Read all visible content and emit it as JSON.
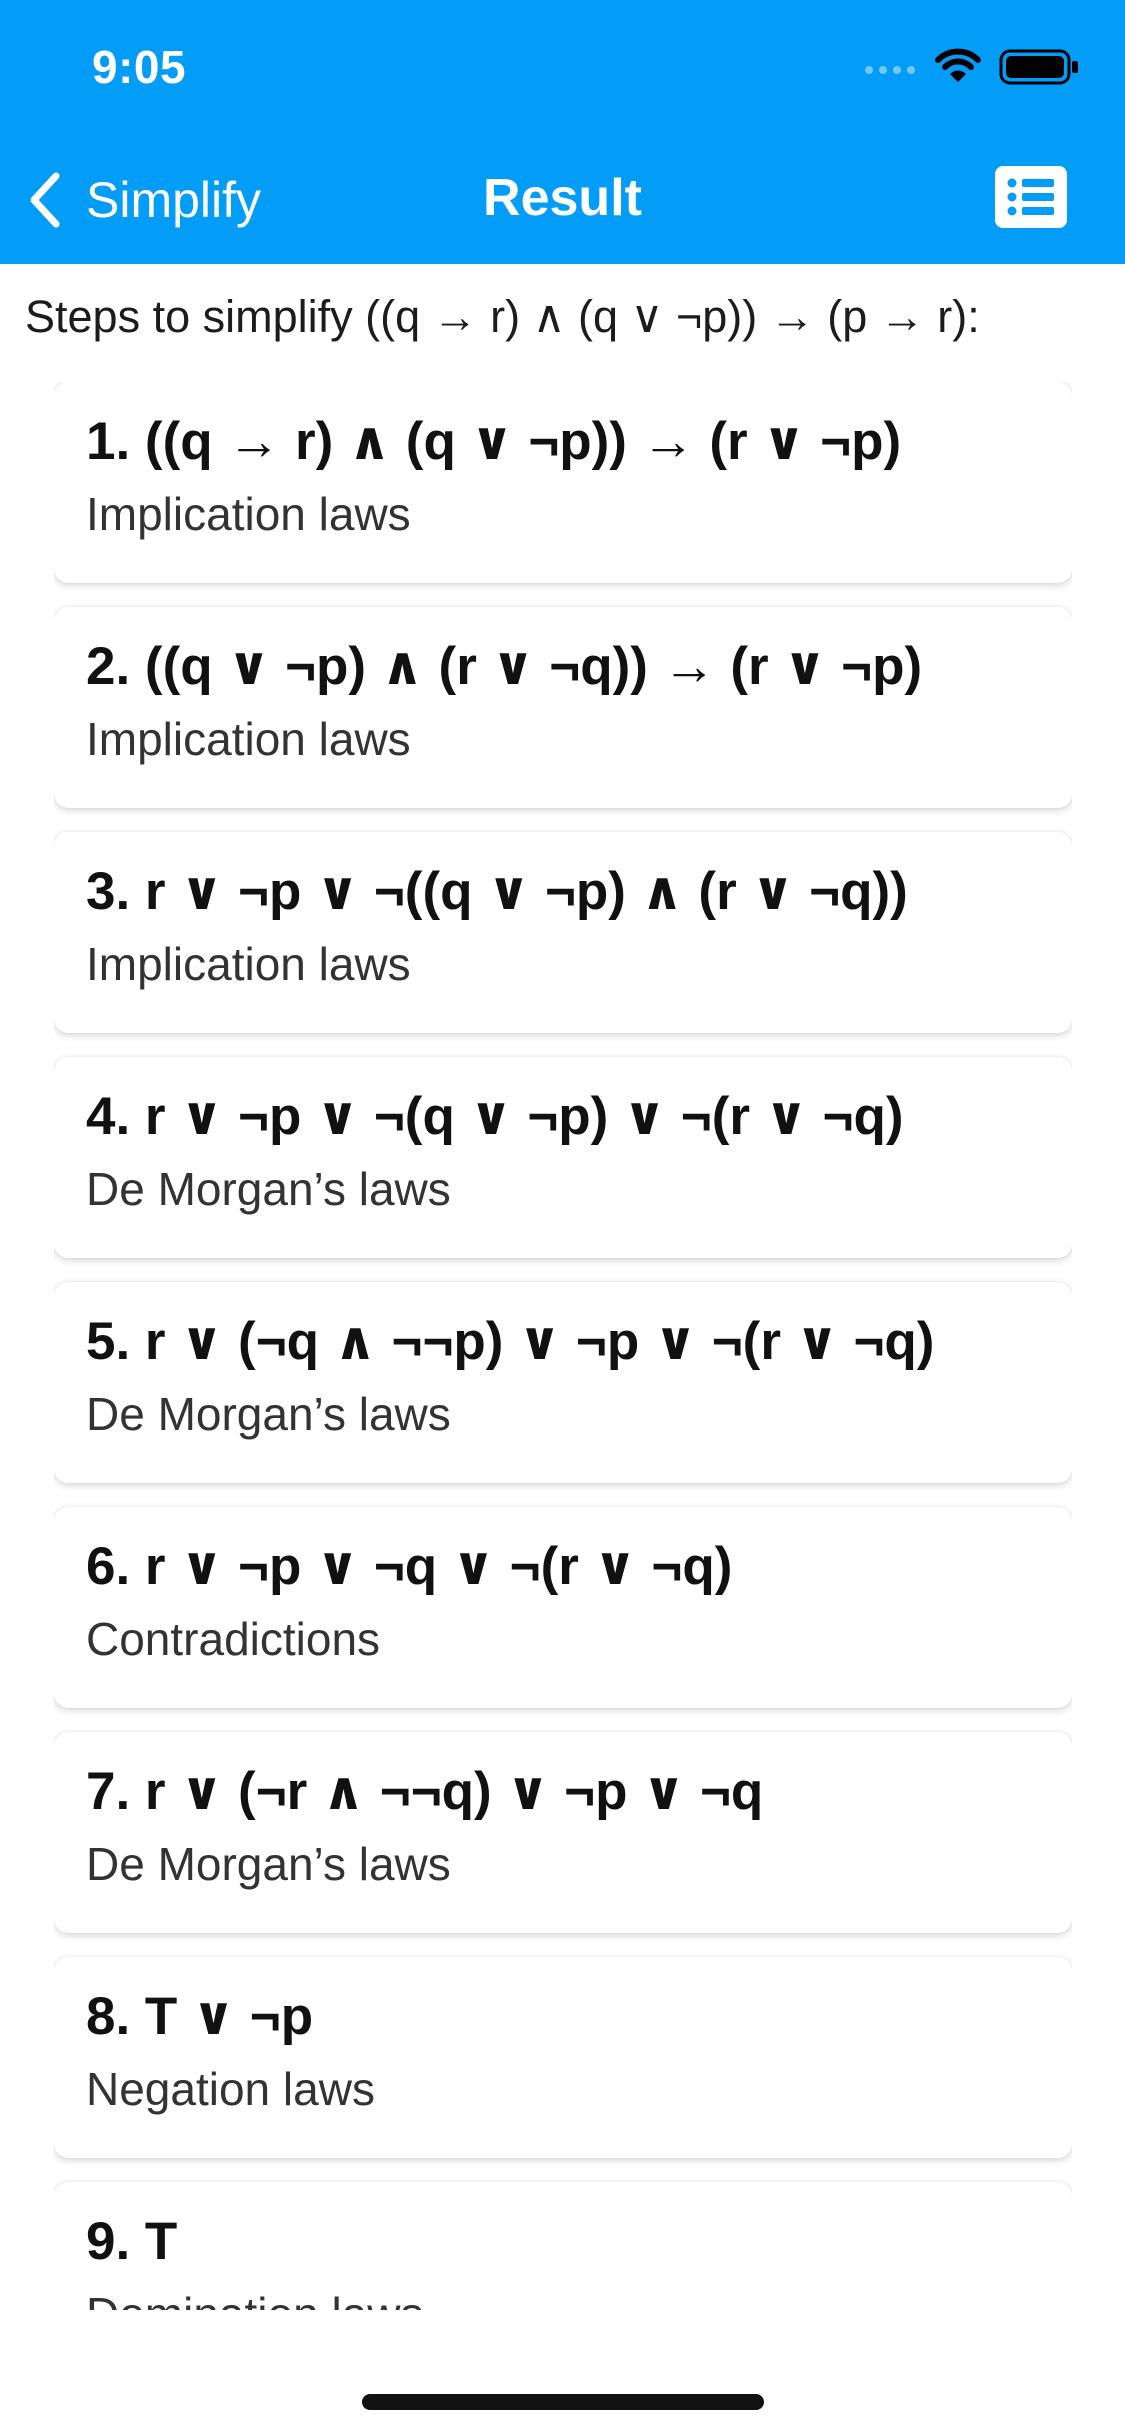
{
  "status_bar": {
    "time": "9:05"
  },
  "nav": {
    "back_label": "Simplify",
    "title": "Result",
    "back_icon": "chevron-left-icon",
    "list_icon": "list-icon"
  },
  "colors": {
    "accent": "#039cf6"
  },
  "heading": "Steps to simplify ((q → r) ∧ (q ∨ ¬p)) → (p → r):",
  "steps": [
    {
      "expr": "1. ((q → r) ∧ (q ∨ ¬p)) → (r ∨ ¬p)",
      "law": "Implication laws"
    },
    {
      "expr": "2. ((q ∨ ¬p) ∧ (r ∨ ¬q)) → (r ∨ ¬p)",
      "law": "Implication laws"
    },
    {
      "expr": "3. r ∨ ¬p ∨ ¬((q ∨ ¬p) ∧ (r ∨ ¬q))",
      "law": "Implication laws"
    },
    {
      "expr": "4. r ∨ ¬p ∨ ¬(q ∨ ¬p) ∨ ¬(r ∨ ¬q)",
      "law": "De Morgan’s laws"
    },
    {
      "expr": "5. r ∨ (¬q ∧ ¬¬p) ∨ ¬p ∨ ¬(r ∨ ¬q)",
      "law": "De Morgan’s laws"
    },
    {
      "expr": "6. r ∨ ¬p ∨ ¬q ∨ ¬(r ∨ ¬q)",
      "law": "Contradictions"
    },
    {
      "expr": "7. r ∨ (¬r ∧ ¬¬q) ∨ ¬p ∨ ¬q",
      "law": "De Morgan’s laws"
    },
    {
      "expr": "8. T ∨ ¬p",
      "law": "Negation laws"
    },
    {
      "expr": "9. T",
      "law": "Domination laws"
    }
  ]
}
